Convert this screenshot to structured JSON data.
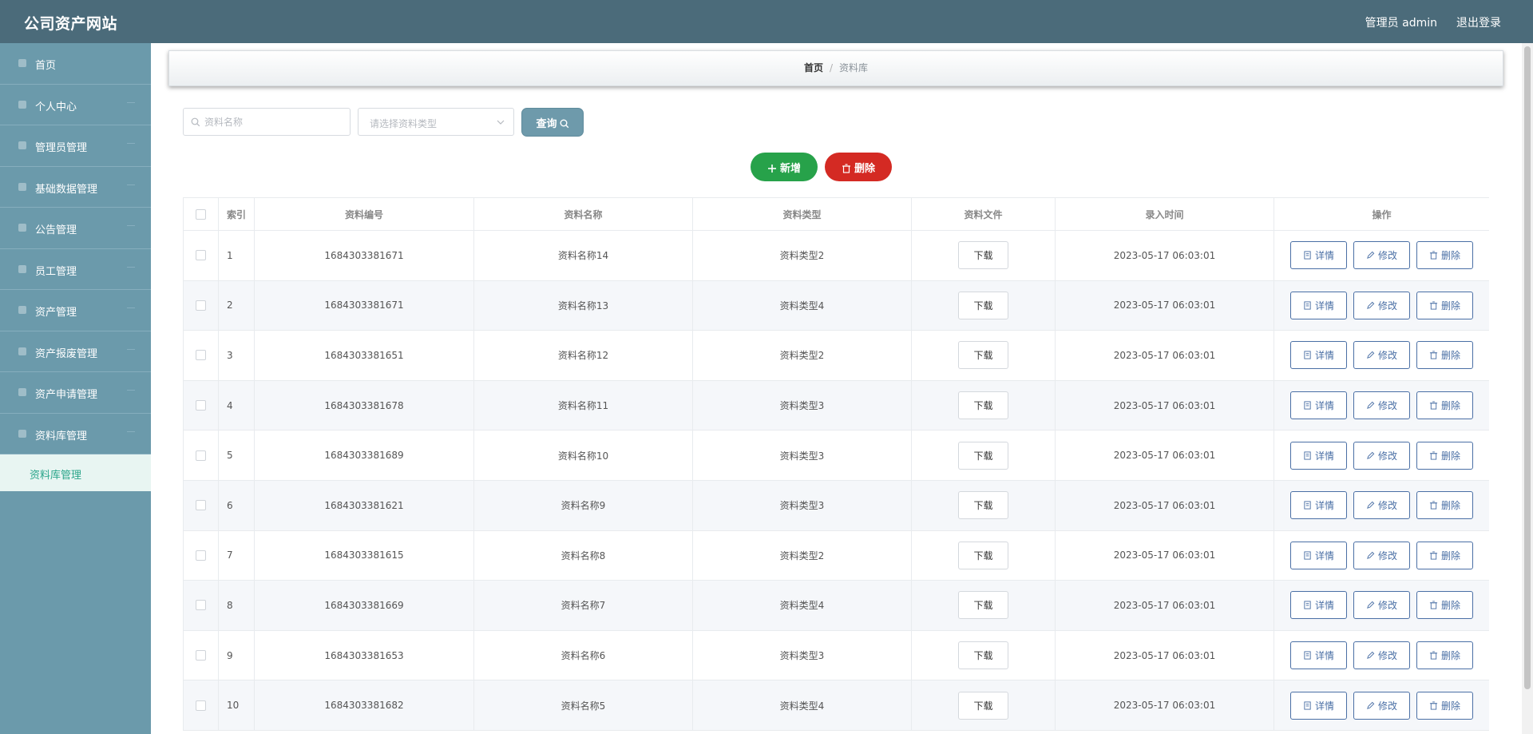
{
  "header": {
    "title": "公司资产网站",
    "user": "管理员 admin",
    "logout": "退出登录"
  },
  "sidebar": {
    "items": [
      {
        "label": "首页",
        "icon": "home-icon",
        "arrow": false
      },
      {
        "label": "个人中心",
        "icon": "user-icon",
        "arrow": true
      },
      {
        "label": "管理员管理",
        "icon": "admin-icon",
        "arrow": true
      },
      {
        "label": "基础数据管理",
        "icon": "data-icon",
        "arrow": true
      },
      {
        "label": "公告管理",
        "icon": "notice-icon",
        "arrow": true
      },
      {
        "label": "员工管理",
        "icon": "staff-icon",
        "arrow": true
      },
      {
        "label": "资产管理",
        "icon": "asset-icon",
        "arrow": true
      },
      {
        "label": "资产报废管理",
        "icon": "scrap-icon",
        "arrow": true
      },
      {
        "label": "资产申请管理",
        "icon": "apply-icon",
        "arrow": true
      },
      {
        "label": "资料库管理",
        "icon": "library-icon",
        "arrow": true
      }
    ],
    "active_sub": "资料库管理"
  },
  "breadcrumb": {
    "home": "首页",
    "separator": "/",
    "current": "资料库"
  },
  "search": {
    "name_placeholder": "资料名称",
    "type_placeholder": "请选择资料类型",
    "query_label": "查询"
  },
  "actions": {
    "add_label": "新增",
    "delete_label": "删除"
  },
  "table": {
    "headers": [
      "索引",
      "资料编号",
      "资料名称",
      "资料类型",
      "资料文件",
      "录入时间",
      "操作"
    ],
    "download_label": "下载",
    "detail_label": "详情",
    "edit_label": "修改",
    "delete_label": "删除",
    "rows": [
      {
        "index": "1",
        "code": "1684303381671",
        "name": "资料名称14",
        "type": "资料类型2",
        "time": "2023-05-17 06:03:01"
      },
      {
        "index": "2",
        "code": "1684303381671",
        "name": "资料名称13",
        "type": "资料类型4",
        "time": "2023-05-17 06:03:01"
      },
      {
        "index": "3",
        "code": "1684303381651",
        "name": "资料名称12",
        "type": "资料类型2",
        "time": "2023-05-17 06:03:01"
      },
      {
        "index": "4",
        "code": "1684303381678",
        "name": "资料名称11",
        "type": "资料类型3",
        "time": "2023-05-17 06:03:01"
      },
      {
        "index": "5",
        "code": "1684303381689",
        "name": "资料名称10",
        "type": "资料类型3",
        "time": "2023-05-17 06:03:01"
      },
      {
        "index": "6",
        "code": "1684303381621",
        "name": "资料名称9",
        "type": "资料类型3",
        "time": "2023-05-17 06:03:01"
      },
      {
        "index": "7",
        "code": "1684303381615",
        "name": "资料名称8",
        "type": "资料类型2",
        "time": "2023-05-17 06:03:01"
      },
      {
        "index": "8",
        "code": "1684303381669",
        "name": "资料名称7",
        "type": "资料类型4",
        "time": "2023-05-17 06:03:01"
      },
      {
        "index": "9",
        "code": "1684303381653",
        "name": "资料名称6",
        "type": "资料类型3",
        "time": "2023-05-17 06:03:01"
      },
      {
        "index": "10",
        "code": "1684303381682",
        "name": "资料名称5",
        "type": "资料类型4",
        "time": "2023-05-17 06:03:01"
      }
    ]
  },
  "colors": {
    "header": "#4b6b7a",
    "sidebar": "#6b9aab",
    "add": "#27a24a",
    "delete": "#d42a23",
    "op_border": "#4a6fa5",
    "active_sub": "#2aa58a"
  }
}
